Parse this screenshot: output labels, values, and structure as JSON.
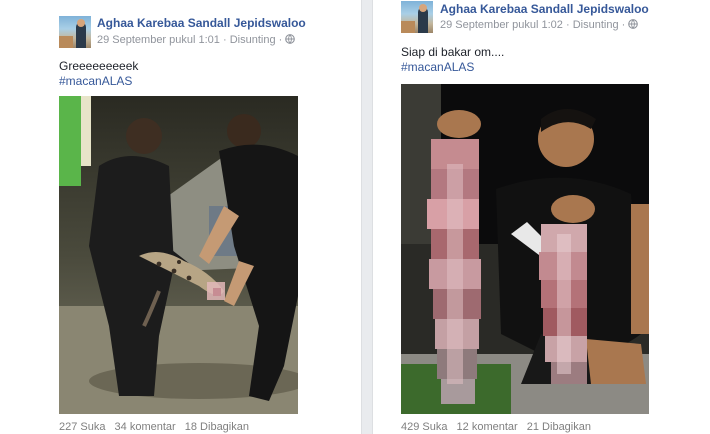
{
  "posts": [
    {
      "author": "Aghaa Karebaa Sandall Jepidswaloo",
      "date": "29 September pukul 1:01",
      "separator": "·",
      "audience_label": "Disunting",
      "text": "Greeeeeeeeek",
      "hashtag": "#macanALAS",
      "stats": {
        "likes": "227 Suka",
        "comments": "34 komentar",
        "shares": "18 Dibagikan"
      }
    },
    {
      "author": "Aghaa Karebaa Sandall Jepidswaloo",
      "date": "29 September pukul 1:02",
      "separator": "·",
      "audience_label": "Disunting",
      "text": "Siap di bakar om....",
      "hashtag": "#macanALAS",
      "stats": {
        "likes": "429 Suka",
        "comments": "12 komentar",
        "shares": "21 Dibagikan"
      }
    }
  ],
  "icons": {
    "audience": "globe-icon",
    "avatar": "profile-photo"
  },
  "colors": {
    "link": "#365899",
    "meta": "#90949c",
    "divider": "#e9ebee"
  }
}
